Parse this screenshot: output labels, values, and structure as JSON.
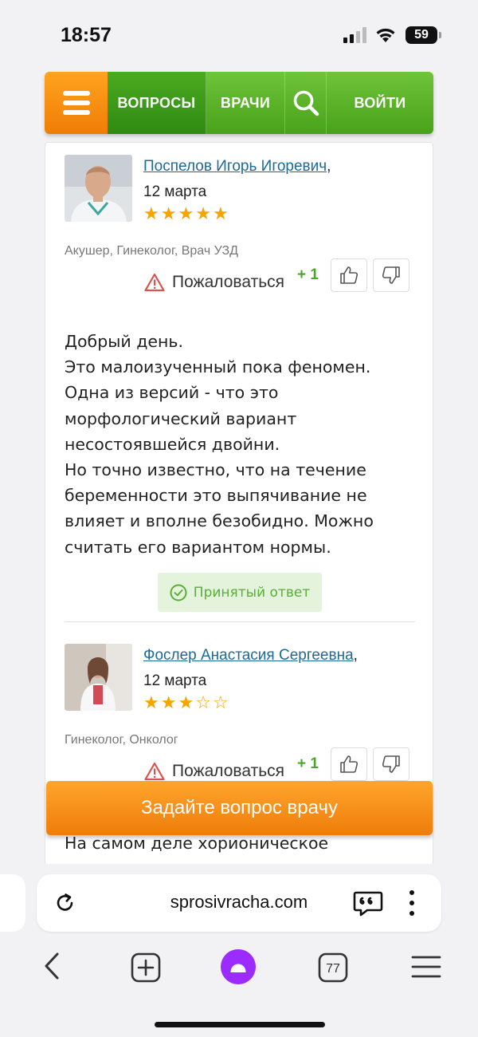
{
  "status": {
    "time": "18:57",
    "battery": "59"
  },
  "nav": {
    "questions": "ВОПРОСЫ",
    "doctors": "ВРАЧИ",
    "login": "ВОЙТИ",
    "menu_icon": "hamburger-icon",
    "search_icon": "search-icon"
  },
  "answers": [
    {
      "doctor": "Поспелов Игорь Игоревич",
      "date": "12 марта",
      "rating": 5,
      "specialty": "Акушер, Гинеколог, Врач УЗД",
      "complain": "Пожаловаться",
      "votes": "+ 1",
      "text": [
        "Добрый день.",
        "Это малоизученный пока феномен.",
        "Одна из версий - что это",
        "морфологический вариант",
        "несостоявшейся двойни.",
        "Но точно известно, что на течение",
        "беременности это выпячивание не",
        "влияет и вполне безобидно. Можно",
        "считать его вариантом нормы."
      ],
      "accepted": "Принятый ответ"
    },
    {
      "doctor": "Фослер Анастасия Сергеевна",
      "date": "12 марта",
      "rating": 3,
      "specialty": "Гинеколог, Онколог",
      "complain": "Пожаловаться",
      "votes": "+ 1",
      "text_preview": "На самом деле хорионическое"
    }
  ],
  "cta": {
    "label": "Задайте вопрос врачу"
  },
  "browser": {
    "url": "sprosivracha.com",
    "tabs_count": "77"
  },
  "colors": {
    "nav_green": "#48a219",
    "nav_orange": "#f07c06",
    "link_blue": "#1e6a95",
    "star": "#f6a400",
    "vote_green": "#4aa62b",
    "accepted_bg": "#e4f4dc",
    "alice_purple": "#9c2bff"
  }
}
